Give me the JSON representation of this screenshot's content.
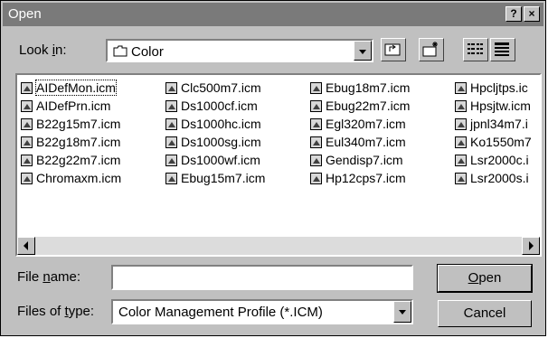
{
  "title": "Open",
  "titlebar_buttons": [
    "?",
    "×"
  ],
  "look_in": {
    "label_pre": "Look ",
    "label_key": "i",
    "label_post": "n:",
    "value": "Color"
  },
  "files": [
    [
      "AIDefMon.icm",
      "AIDefPrn.icm",
      "B22g15m7.icm",
      "B22g18m7.icm",
      "B22g22m7.icm",
      "Chromaxm.icm"
    ],
    [
      "Clc500m7.icm",
      "Ds1000cf.icm",
      "Ds1000hc.icm",
      "Ds1000sg.icm",
      "Ds1000wf.icm",
      "Ebug15m7.icm"
    ],
    [
      "Ebug18m7.icm",
      "Ebug22m7.icm",
      "Egl320m7.icm",
      "Eul340m7.icm",
      "Gendisp7.icm",
      "Hp12cps7.icm"
    ],
    [
      "Hpcljtps.ic",
      "Hpsjtw.icm",
      "jpnl34m7.i",
      "Ko1550m7",
      "Lsr2000c.i",
      "Lsr2000s.i"
    ]
  ],
  "file_name": {
    "label_pre": "File ",
    "label_key": "n",
    "label_post": "ame:",
    "value": ""
  },
  "file_type": {
    "label_pre": "Files of ",
    "label_key": "t",
    "label_post": "ype:",
    "value": "Color Management Profile (*.ICM)"
  },
  "buttons": {
    "open_key": "O",
    "open_rest": "pen",
    "cancel": "Cancel"
  }
}
